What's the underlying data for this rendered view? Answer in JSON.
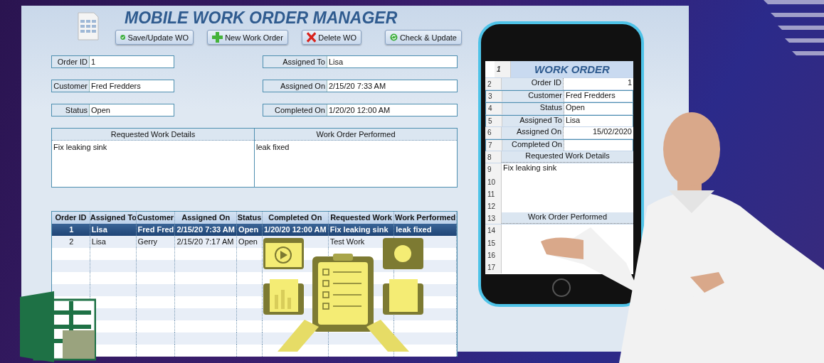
{
  "header": {
    "title": "MOBILE WORK ORDER MANAGER"
  },
  "buttons": [
    {
      "label": "Save/Update WO",
      "kind": "save"
    },
    {
      "label": "New Work Order",
      "kind": "new"
    },
    {
      "label": "Delete WO",
      "kind": "delete"
    },
    {
      "label": "Check & Update",
      "kind": "refresh"
    }
  ],
  "left_fields": [
    {
      "label": "Order ID",
      "value": "1"
    },
    {
      "label": "Customer",
      "value": "Fred Fredders"
    },
    {
      "label": "Status",
      "value": "Open"
    }
  ],
  "right_fields": [
    {
      "label": "Assigned To",
      "value": "Lisa"
    },
    {
      "label": "Assigned On",
      "value": "2/15/20 7:33 AM"
    },
    {
      "label": "Completed On",
      "value": "1/20/20 12:00 AM"
    }
  ],
  "details": [
    {
      "heading": "Requested Work Details",
      "text": "Fix leaking sink"
    },
    {
      "heading": "Work Order Performed",
      "text": "leak fixed"
    }
  ],
  "table": {
    "columns": [
      "Order ID",
      "Assigned To",
      "Customer",
      "Assigned On",
      "Status",
      "Completed On",
      "Requested Work",
      "Work Performed"
    ],
    "rows": [
      {
        "selected": true,
        "cells": [
          "1",
          "Lisa",
          "Fred Fred",
          "2/15/20 7:33 AM",
          "Open",
          "1/20/20 12:00 AM",
          "Fix leaking sink",
          "leak fixed"
        ]
      },
      {
        "selected": false,
        "cells": [
          "2",
          "Lisa",
          "Gerry",
          "2/15/20 7:17 AM",
          "Open",
          "",
          "Test Work",
          ""
        ]
      }
    ]
  },
  "phone": {
    "rows": [
      {
        "number": "1",
        "kind": "title",
        "text": "WORK ORDER"
      },
      {
        "number": "2",
        "kind": "number-field",
        "label": "Order ID",
        "value": "1"
      },
      {
        "number": "3",
        "kind": "field",
        "label": "Customer",
        "value": "Fred Fredders"
      },
      {
        "number": "4",
        "kind": "field",
        "label": "Status",
        "value": "Open"
      },
      {
        "number": "5",
        "kind": "field",
        "label": "Assigned To",
        "value": "Lisa"
      },
      {
        "number": "6",
        "kind": "number-field",
        "label": "Assigned On",
        "value": "15/02/2020"
      },
      {
        "number": "7",
        "kind": "field",
        "label": "Completed On"
      },
      {
        "number": "8",
        "kind": "heading",
        "text": "Requested Work Details"
      },
      {
        "number": "9",
        "kind": "text",
        "text": "Fix leaking sink"
      },
      {
        "number": "10",
        "kind": "text"
      },
      {
        "number": "11",
        "kind": "text"
      },
      {
        "number": "12",
        "kind": "text"
      },
      {
        "number": "13",
        "kind": "heading",
        "text": "Work Order Performed"
      },
      {
        "number": "14",
        "kind": "text"
      },
      {
        "number": "15",
        "kind": "text"
      },
      {
        "number": "16",
        "kind": "text"
      },
      {
        "number": "17",
        "kind": "text"
      }
    ]
  }
}
